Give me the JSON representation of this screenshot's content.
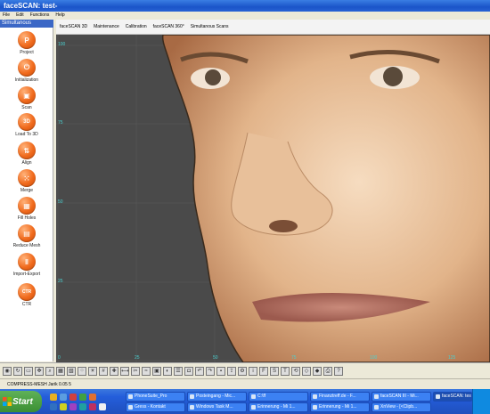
{
  "window": {
    "title": "faceSCAN: test-"
  },
  "menu": [
    "File",
    "Edit",
    "Functions",
    "Help"
  ],
  "left_tab": "Simultanous",
  "top_nav": [
    "faceSCAN 3D",
    "Maintenance",
    "Calibration",
    "faceSCAN 360°",
    "Simultanous Scans"
  ],
  "sidebar": {
    "tools": [
      {
        "label": "Project",
        "glyph": "P",
        "icon": "project-icon"
      },
      {
        "label": "Initialization",
        "glyph": "⏻",
        "icon": "power-icon"
      },
      {
        "label": "Scan",
        "glyph": "▣",
        "icon": "scan-icon"
      },
      {
        "label": "Load To 3D",
        "glyph": "3D",
        "icon": "load-3d-icon"
      },
      {
        "label": "Align",
        "glyph": "⇅",
        "icon": "align-icon"
      },
      {
        "label": "Merge",
        "glyph": "⁙",
        "icon": "merge-icon"
      },
      {
        "label": "Fill Holes",
        "glyph": "▦",
        "icon": "fill-holes-icon"
      },
      {
        "label": "Reduce Mesh",
        "glyph": "▤",
        "icon": "reduce-mesh-icon"
      },
      {
        "label": "Import-Export",
        "glyph": "‖",
        "icon": "import-export-icon"
      },
      {
        "label": "CTR",
        "glyph": "CTR",
        "icon": "ctr-icon"
      }
    ]
  },
  "viewport": {
    "y_ticks": [
      "100",
      "75",
      "50",
      "25",
      "0"
    ],
    "x_ticks": [
      "25",
      "50",
      "75",
      "100",
      "125"
    ]
  },
  "status": "COMPRESS-MESH Jarik 0.05 5",
  "taskbar": {
    "start": "Start",
    "tasks_top": [
      "PhoneSuite_Pro",
      "Posteingang - Mic...",
      "C:\\ff",
      "Finanztreff.de - F...",
      "faceSCAN III - Mi...",
      "faceSCAN: test-"
    ],
    "tasks_bottom": [
      "Gress - Kontakt",
      "Windows Task M...",
      "Erinnerung - Mi 1...",
      "Erinnerung - Mi 1...",
      "XnView - [<Clipb..."
    ]
  }
}
